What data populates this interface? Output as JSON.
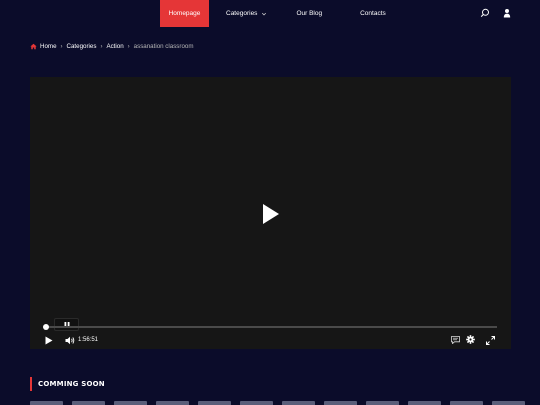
{
  "nav": {
    "items": [
      {
        "label": "Homepage",
        "active": true
      },
      {
        "label": "Categories",
        "active": false
      },
      {
        "label": "Our Blog",
        "active": false
      },
      {
        "label": "Contacts",
        "active": false
      }
    ]
  },
  "breadcrumb": {
    "home": "Home",
    "categories": "Categories",
    "genre": "Action",
    "current": "assanation classroom"
  },
  "player": {
    "time": "1:56:51",
    "progress": 0.005
  },
  "section": {
    "title": "COMMING SOON"
  },
  "thumbnail_count": 12,
  "colors": {
    "accent": "#e53637",
    "background": "#0b0c2a",
    "player": "#161616"
  }
}
